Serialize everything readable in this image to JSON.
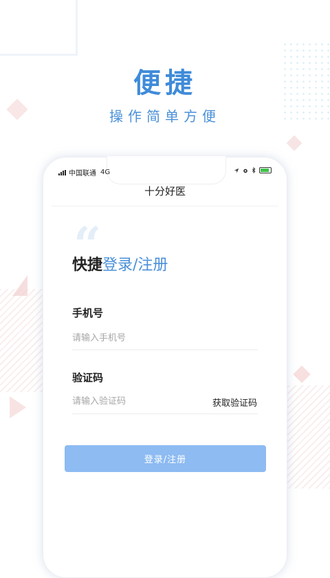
{
  "promo": {
    "title": "便捷",
    "subtitle": "操作简单方便"
  },
  "status_bar": {
    "carrier": "中国联通",
    "network": "4G",
    "icons": [
      "location-icon",
      "alarm-icon",
      "bluetooth-icon",
      "battery-icon"
    ],
    "battery_color": "#3ec24a"
  },
  "app": {
    "title": "十分好医"
  },
  "login": {
    "heading_main": "快捷",
    "heading_accent": "登录/注册",
    "phone_label": "手机号",
    "phone_placeholder": "请输入手机号",
    "phone_value": "",
    "code_label": "验证码",
    "code_placeholder": "请输入验证码",
    "code_value": "",
    "get_code_label": "获取验证码",
    "submit_label": "登录/注册"
  },
  "colors": {
    "accent": "#4a8fd8",
    "button": "#8dbbf2"
  }
}
